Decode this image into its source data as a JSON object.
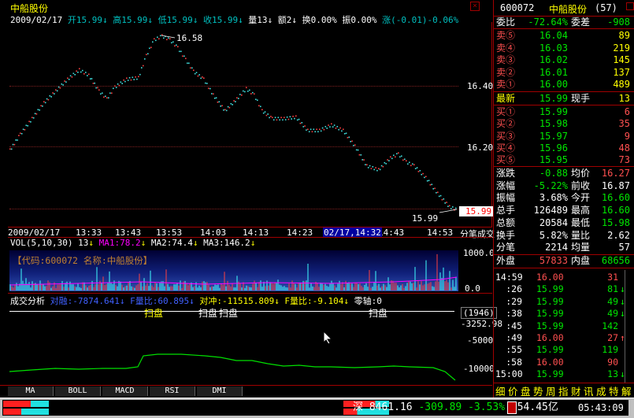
{
  "stock": {
    "title": "中船股份",
    "date": "2009/02/17",
    "ohlc_line": [
      {
        "t": "开",
        "v": "15.99",
        "arr": "↓",
        "c": "cyan"
      },
      {
        "t": "高",
        "v": "15.99",
        "arr": "↓",
        "c": "cyan"
      },
      {
        "t": "低",
        "v": "15.99",
        "arr": "↓",
        "c": "cyan"
      },
      {
        "t": "收",
        "v": "15.99",
        "arr": "↓",
        "c": "cyan"
      },
      {
        "t": "量",
        "v": "13",
        "arr": "↓",
        "c": "white"
      },
      {
        "t": "额",
        "v": "2",
        "arr": "↓",
        "c": "white"
      },
      {
        "t": "换",
        "v": "0.00%",
        "arr": "",
        "c": "white"
      },
      {
        "t": "振",
        "v": "0.00%",
        "arr": "",
        "c": "white"
      },
      {
        "t": "涨",
        "v": "(-0.01)-0.06%",
        "arr": "",
        "c": "cyan"
      }
    ]
  },
  "price_chart": {
    "high_label": "16.58",
    "low_label": "15.99",
    "current_price": "15.99",
    "y_ticks": [
      "16.40",
      "16.20"
    ],
    "x_labels": [
      "2009/02/17",
      "13:33",
      "13:43",
      "13:53",
      "14:03",
      "14:13",
      "14:23",
      "14:43",
      "14:53"
    ],
    "cursor_label": "02/17,14:32",
    "right_header": "分笔成交"
  },
  "vol_panel": {
    "legend_prefix": "VOL(5,10,30)",
    "vol_value": "13",
    "ma1": "MA1:78.2",
    "ma2": "MA2:74.4",
    "ma3": "MA3:146.2",
    "banner": "【代码:600072 名称:中船股份】",
    "y_ticks": [
      "1000.0",
      "0.0"
    ]
  },
  "analysis_panel": {
    "title": "成交分析",
    "legend": [
      {
        "text": "对融:-7874.641",
        "c": "blue"
      },
      {
        "text": "F量比:60.895",
        "c": "blue"
      },
      {
        "text": "对冲:-11515.809",
        "c": "yellow"
      },
      {
        "text": "F量比:-9.104",
        "c": "yellow"
      },
      {
        "text": "零轴:0",
        "c": "white"
      }
    ],
    "labels": [
      "扫盘",
      "扫盘",
      "扫盘",
      "扫盘"
    ],
    "badge": "(1946)",
    "y_ticks": [
      "-3252.98",
      "-5000",
      "-10000"
    ]
  },
  "bottom_tabs": [
    "MA",
    "BOLL",
    "MACD",
    "RSI",
    "DMI"
  ],
  "quote": {
    "code": "600072",
    "name": "中船股份",
    "count": "(57)",
    "wei_bi": "委比",
    "wei_bi_val": "-72.64%",
    "wei_cha": "委差",
    "wei_cha_val": "-908",
    "asks": [
      {
        "lbl": "卖⑤",
        "p": "16.04",
        "v": "89"
      },
      {
        "lbl": "卖④",
        "p": "16.03",
        "v": "219"
      },
      {
        "lbl": "卖③",
        "p": "16.02",
        "v": "145"
      },
      {
        "lbl": "卖②",
        "p": "16.01",
        "v": "137"
      },
      {
        "lbl": "卖①",
        "p": "16.00",
        "v": "489"
      }
    ],
    "latest_lbl": "最新",
    "latest": "15.99",
    "now_hand_lbl": "现手",
    "now_hand": "13",
    "bids": [
      {
        "lbl": "买①",
        "p": "15.99",
        "v": "6"
      },
      {
        "lbl": "买②",
        "p": "15.98",
        "v": "35"
      },
      {
        "lbl": "买③",
        "p": "15.97",
        "v": "9"
      },
      {
        "lbl": "买④",
        "p": "15.96",
        "v": "48"
      },
      {
        "lbl": "买⑤",
        "p": "15.95",
        "v": "73"
      }
    ],
    "stats": [
      {
        "l1": "涨跌",
        "v1": "-0.88",
        "c1": "green",
        "l2": "均价",
        "v2": "16.27",
        "c2": "red"
      },
      {
        "l1": "涨幅",
        "v1": "-5.22%",
        "c1": "green",
        "l2": "前收",
        "v2": "16.87",
        "c2": "white"
      },
      {
        "l1": "振幅",
        "v1": "3.68%",
        "c1": "white",
        "l2": "今开",
        "v2": "16.60",
        "c2": "green"
      },
      {
        "l1": "总手",
        "v1": "126489",
        "c1": "white",
        "l2": "最高",
        "v2": "16.60",
        "c2": "green"
      },
      {
        "l1": "总额",
        "v1": "20584",
        "c1": "white",
        "l2": "最低",
        "v2": "15.98",
        "c2": "green"
      },
      {
        "l1": "换手",
        "v1": "5.82%",
        "c1": "white",
        "l2": "量比",
        "v2": "2.62",
        "c2": "white"
      },
      {
        "l1": "分笔",
        "v1": "2214",
        "c1": "white",
        "l2": "均量",
        "v2": "57",
        "c2": "white"
      }
    ],
    "outer_lbl": "外盘",
    "outer": "57833",
    "inner_lbl": "内盘",
    "inner": "68656",
    "trades": [
      {
        "t": "14:59",
        "p": "16.00",
        "pc": "red",
        "v": "31",
        "arr": "",
        "vc": "red"
      },
      {
        "t": ":26",
        "p": "15.99",
        "pc": "green",
        "v": "81",
        "arr": "↓",
        "vc": "green"
      },
      {
        "t": ":29",
        "p": "15.99",
        "pc": "green",
        "v": "49",
        "arr": "↓",
        "vc": "green"
      },
      {
        "t": ":38",
        "p": "15.99",
        "pc": "green",
        "v": "49",
        "arr": "↓",
        "vc": "green"
      },
      {
        "t": ":45",
        "p": "15.99",
        "pc": "green",
        "v": "142",
        "arr": "",
        "vc": "green"
      },
      {
        "t": ":49",
        "p": "16.00",
        "pc": "red",
        "v": "27",
        "arr": "↑",
        "vc": "red"
      },
      {
        "t": ":55",
        "p": "15.99",
        "pc": "green",
        "v": "119",
        "arr": "",
        "vc": "green"
      },
      {
        "t": ":58",
        "p": "16.00",
        "pc": "red",
        "v": "90",
        "arr": "",
        "vc": "red"
      },
      {
        "t": "15:00",
        "p": "15.99",
        "pc": "green",
        "v": "13",
        "arr": "↓",
        "vc": "green"
      }
    ],
    "bottom_tabs": [
      "细",
      "价",
      "盘",
      "势",
      "周",
      "指",
      "财",
      "讯",
      "成",
      "特",
      "解"
    ]
  },
  "status_bar": {
    "market": "深",
    "index": "8461.16",
    "change": "-309.89",
    "pct": "-3.53%",
    "amount": "854.45亿",
    "time": "05:43:09"
  }
}
